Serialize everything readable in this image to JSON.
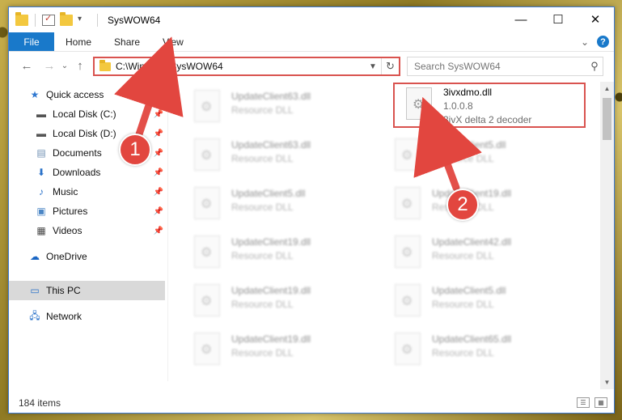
{
  "window": {
    "title": "SysWOW64",
    "controls": {
      "minimize": "—",
      "maximize": "☐",
      "close": "✕"
    }
  },
  "ribbon": {
    "tabs": [
      "File",
      "Home",
      "Share",
      "View"
    ],
    "help": "?",
    "collapse": "⌄"
  },
  "nav": {
    "back": "←",
    "forward": "→",
    "recent": "⌄",
    "up": "↑",
    "address": "C:\\Windows\\SysWOW64",
    "search_placeholder": "Search SysWOW64"
  },
  "sidebar": {
    "items": [
      {
        "label": "Quick access",
        "icon": "star-icon"
      },
      {
        "label": "Local Disk (C:)",
        "icon": "drive-icon",
        "pinned": true
      },
      {
        "label": "Local Disk (D:)",
        "icon": "drive-icon",
        "pinned": true
      },
      {
        "label": "Documents",
        "icon": "documents-icon",
        "pinned": true
      },
      {
        "label": "Downloads",
        "icon": "download-icon",
        "pinned": true
      },
      {
        "label": "Music",
        "icon": "music-icon",
        "pinned": true
      },
      {
        "label": "Pictures",
        "icon": "pictures-icon",
        "pinned": true
      },
      {
        "label": "Videos",
        "icon": "videos-icon",
        "pinned": true
      },
      {
        "label": "OneDrive",
        "icon": "cloud-icon"
      },
      {
        "label": "This PC",
        "icon": "computer-icon",
        "selected": true
      },
      {
        "label": "Network",
        "icon": "network-icon"
      }
    ]
  },
  "files": {
    "left": [
      {
        "name": "UpdateClient63.dll",
        "desc": "Resource DLL"
      },
      {
        "name": "UpdateClient63.dll",
        "desc": "Resource DLL"
      },
      {
        "name": "UpdateClient5.dll",
        "desc": "Resource DLL"
      },
      {
        "name": "UpdateClient19.dll",
        "desc": "Resource DLL"
      },
      {
        "name": "UpdateClient19.dll",
        "desc": "Resource DLL"
      },
      {
        "name": "UpdateClient19.dll",
        "desc": "Resource DLL"
      }
    ],
    "right": [
      {
        "name": "UpdateClient5.dll",
        "desc": "Resource DLL"
      },
      {
        "name": "UpdateClient19.dll",
        "desc": "Resource DLL"
      },
      {
        "name": "UpdateClient42.dll",
        "desc": "Resource DLL"
      },
      {
        "name": "UpdateClient5.dll",
        "desc": "Resource DLL"
      },
      {
        "name": "UpdateClient65.dll",
        "desc": "Resource DLL"
      }
    ],
    "highlighted": {
      "name": "3ivxdmo.dll",
      "version": "1.0.0.8",
      "desc": "3ivX delta 2 decoder"
    }
  },
  "status": {
    "items": "184 items"
  },
  "annotations": {
    "step1": "1",
    "step2": "2",
    "color": "#e2463f"
  }
}
